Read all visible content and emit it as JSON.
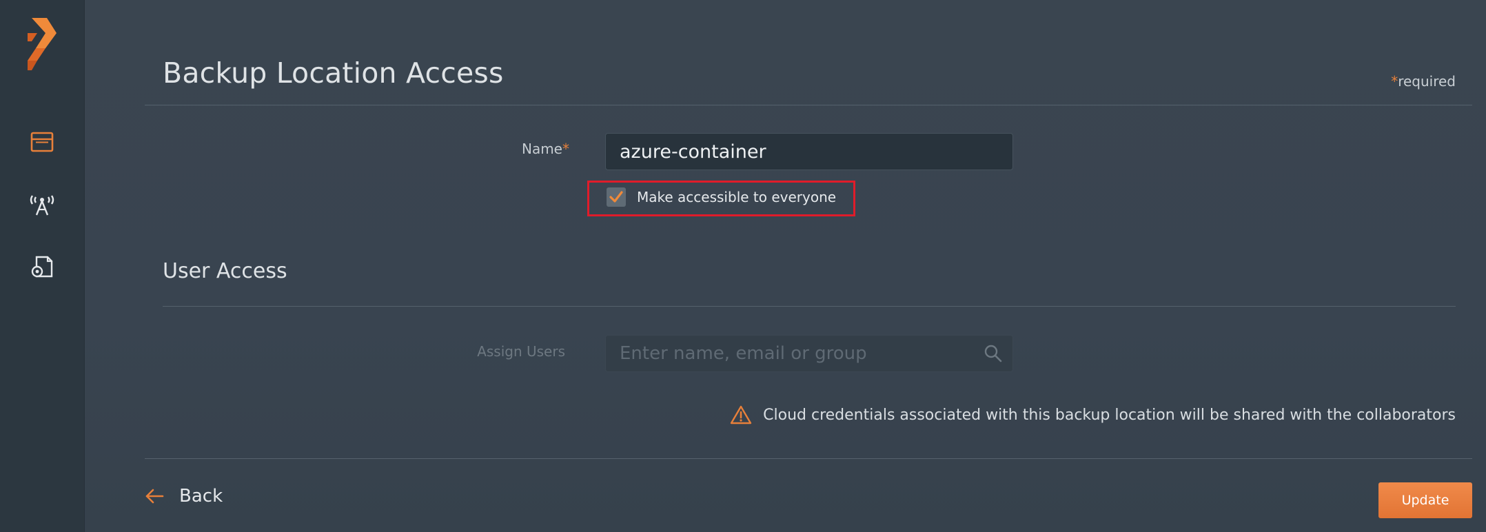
{
  "page": {
    "title": "Backup Location Access",
    "required_star": "*",
    "required_text": "required"
  },
  "form": {
    "name_label": "Name",
    "name_required_star": "*",
    "name_value": "azure-container",
    "accessible_checkbox": {
      "label": "Make accessible to everyone",
      "checked": true
    }
  },
  "user_access": {
    "title": "User Access",
    "assign_label": "Assign Users",
    "search_placeholder": "Enter name, email or group",
    "warning_text": "Cloud credentials associated with this backup location will be shared with the collaborators"
  },
  "footer": {
    "back_label": "Back",
    "update_label": "Update"
  },
  "icons": {
    "logo": "portworx-logo",
    "nav1": "window-icon",
    "nav2": "antenna-icon",
    "nav3": "document-settings-icon",
    "search": "search-icon",
    "warning": "warning-triangle-icon",
    "back": "arrow-left-icon",
    "check": "checkmark-icon"
  },
  "colors": {
    "accent": "#e8803a",
    "background": "#3a4550",
    "sidebar": "#2c3740",
    "highlight": "#e01c2a"
  }
}
